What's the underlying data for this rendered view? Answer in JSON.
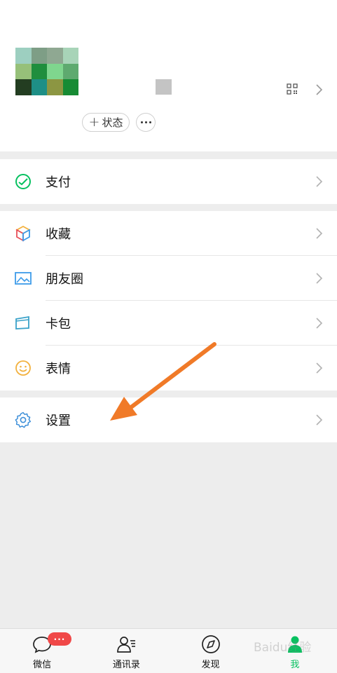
{
  "profile": {
    "status_label": "状态",
    "status_prefix": "+",
    "avatar_colors": [
      "#9dcfc0",
      "#7e9e86",
      "#8fa892",
      "#a8d4b8",
      "#96c079",
      "#1f8e3d",
      "#7fd68e",
      "#5eaa6f",
      "#233d21",
      "#1e8f86",
      "#8c9642",
      "#178b34"
    ]
  },
  "menu": {
    "pay": {
      "label": "支付"
    },
    "favorites": {
      "label": "收藏"
    },
    "moments": {
      "label": "朋友圈"
    },
    "cards": {
      "label": "卡包"
    },
    "stickers": {
      "label": "表情"
    },
    "settings": {
      "label": "设置"
    }
  },
  "tabbar": {
    "tabs": [
      {
        "label": "微信",
        "badge": "···"
      },
      {
        "label": "通讯录"
      },
      {
        "label": "发现"
      },
      {
        "label": "我",
        "active": true
      }
    ]
  },
  "colors": {
    "accent": "#07c160",
    "arrow": "#f07a28",
    "badge": "#f04848",
    "background": "#ededed"
  },
  "watermark": {
    "text": "Baidu经验"
  }
}
